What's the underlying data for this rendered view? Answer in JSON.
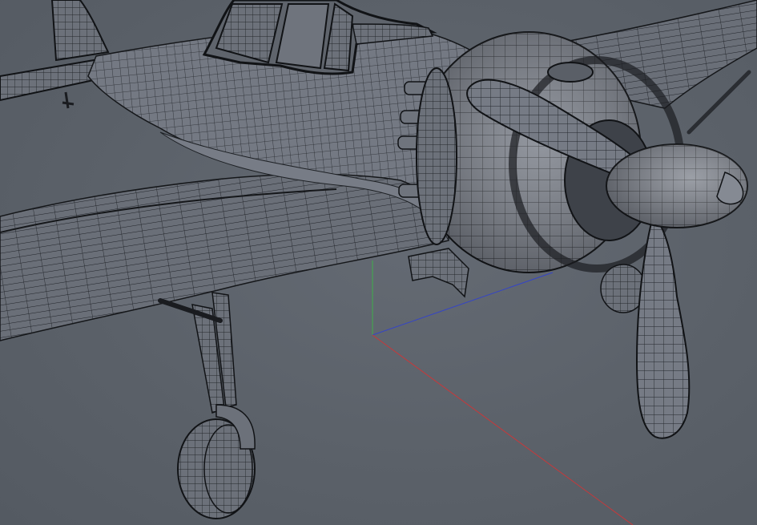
{
  "viewport": {
    "background": "#5c626a",
    "shading": "wireframe-on-shaded",
    "mesh_fill": "#6b7079",
    "wire_color": "#1b1d21",
    "axes": {
      "x_color": "#c8383a",
      "y_color": "#3fae4a",
      "z_color": "#3444c8"
    }
  },
  "model": {
    "parts": [
      "fuselage",
      "canopy",
      "vertical-stabilizer",
      "horizontal-stabilizer",
      "left-wing",
      "right-wing",
      "engine-cowling",
      "propeller-spinner",
      "propeller-blade-upper",
      "propeller-blade-lower",
      "exhaust-stacks",
      "landing-gear-strut",
      "landing-gear-wheel",
      "tail-wheel",
      "radiator-scoop"
    ]
  }
}
